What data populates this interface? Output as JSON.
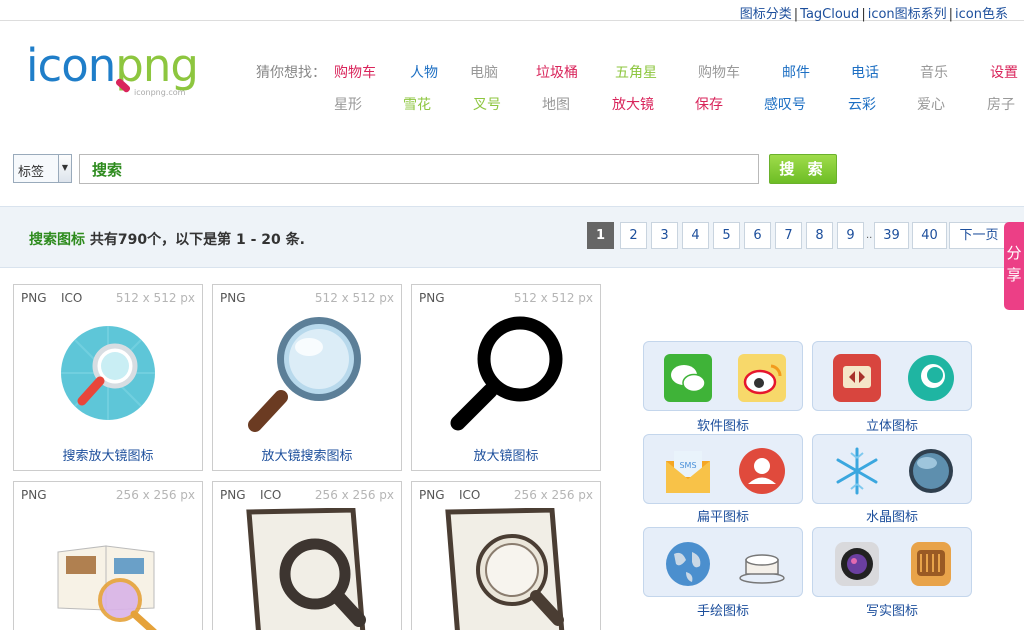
{
  "toplinks": [
    "图标分类",
    "TagCloud",
    "icon图标系列",
    "icon色系"
  ],
  "logo": {
    "icon_part": "icon",
    "png_part": "png",
    "sub": "iconpng.com"
  },
  "suggest": {
    "label": "猜你想找：",
    "row1": [
      {
        "text": "购物车",
        "color": "#d9255b"
      },
      {
        "text": "人物",
        "color": "#1d6fc3"
      },
      {
        "text": "电脑",
        "color": "#999999"
      },
      {
        "text": "垃圾桶",
        "color": "#d9255b"
      },
      {
        "text": "五角星",
        "color": "#8dc63f"
      },
      {
        "text": "购物车",
        "color": "#999999"
      },
      {
        "text": "邮件",
        "color": "#1d6fc3"
      },
      {
        "text": "电话",
        "color": "#1d6fc3"
      },
      {
        "text": "音乐",
        "color": "#999999"
      },
      {
        "text": "设置",
        "color": "#d9255b"
      }
    ],
    "row2": [
      {
        "text": "星形",
        "color": "#999999"
      },
      {
        "text": "雪花",
        "color": "#8dc63f"
      },
      {
        "text": "叉号",
        "color": "#8dc63f"
      },
      {
        "text": "地图",
        "color": "#999999"
      },
      {
        "text": "放大镜",
        "color": "#d9255b"
      },
      {
        "text": "保存",
        "color": "#d9255b"
      },
      {
        "text": "感叹号",
        "color": "#1d6fc3"
      },
      {
        "text": "云彩",
        "color": "#1d6fc3"
      },
      {
        "text": "爱心",
        "color": "#999999"
      },
      {
        "text": "房子",
        "color": "#999999"
      }
    ]
  },
  "search": {
    "select_value": "标签",
    "input_value": "搜索",
    "button_label": "搜 索"
  },
  "results": {
    "prefix": "搜索图标",
    "text": " 共有790个，以下是第 1 - 20 条."
  },
  "pager": {
    "pages": [
      "1",
      "2",
      "3",
      "4",
      "5",
      "6",
      "7",
      "8",
      "9"
    ],
    "dots": "..",
    "tail": [
      "39",
      "40"
    ],
    "next": "下一页",
    "active": "1"
  },
  "share": {
    "label": "分享"
  },
  "cards": [
    {
      "formats": [
        "PNG",
        "ICO"
      ],
      "size": "512 x 512 px",
      "name": "搜索放大镜图标"
    },
    {
      "formats": [
        "PNG"
      ],
      "size": "512 x 512 px",
      "name": "放大镜搜索图标"
    },
    {
      "formats": [
        "PNG"
      ],
      "size": "512 x 512 px",
      "name": "放大镜图标"
    },
    {
      "formats": [
        "PNG"
      ],
      "size": "256 x 256 px",
      "name": ""
    },
    {
      "formats": [
        "PNG",
        "ICO"
      ],
      "size": "256 x 256 px",
      "name": ""
    },
    {
      "formats": [
        "PNG",
        "ICO"
      ],
      "size": "256 x 256 px",
      "name": ""
    }
  ],
  "categories": [
    {
      "label": "软件图标",
      "icons": [
        "wechat-icon",
        "weibo-icon"
      ]
    },
    {
      "label": "立体图标",
      "icons": [
        "red-app-icon",
        "teal-swirl-icon"
      ]
    },
    {
      "label": "扁平图标",
      "icons": [
        "sms-envelope-icon",
        "user-circle-icon"
      ]
    },
    {
      "label": "水晶图标",
      "icons": [
        "snowflake-icon",
        "crystal-globe-icon"
      ]
    },
    {
      "label": "手绘图标",
      "icons": [
        "globe-sketch-icon",
        "cake-sketch-icon"
      ]
    },
    {
      "label": "写实图标",
      "icons": [
        "camera-lens-icon",
        "radio-icon"
      ]
    }
  ]
}
